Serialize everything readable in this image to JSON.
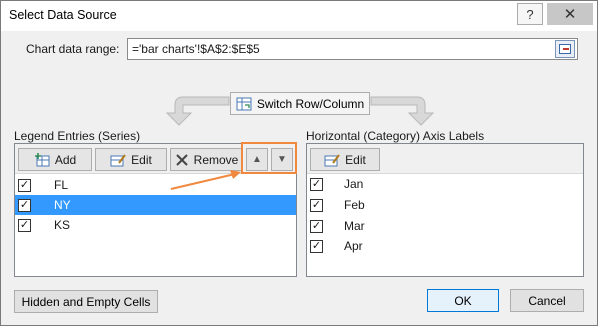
{
  "window": {
    "title": "Select Data Source",
    "help_glyph": "?",
    "close_glyph": "✕"
  },
  "range": {
    "label": "Chart data range:",
    "value": "='bar charts'!$A$2:$E$5"
  },
  "switch_button": {
    "label": "Switch Row/Column"
  },
  "legend": {
    "heading": "Legend Entries (Series)",
    "add_label": "Add",
    "edit_label": "Edit",
    "remove_label": "Remove",
    "items": [
      {
        "label": "FL",
        "checked": true,
        "selected": false
      },
      {
        "label": "NY",
        "checked": true,
        "selected": true
      },
      {
        "label": "KS",
        "checked": true,
        "selected": false
      }
    ]
  },
  "axis": {
    "heading": "Horizontal (Category) Axis Labels",
    "edit_label": "Edit",
    "items": [
      {
        "label": "Jan",
        "checked": true
      },
      {
        "label": "Feb",
        "checked": true
      },
      {
        "label": "Mar",
        "checked": true
      },
      {
        "label": "Apr",
        "checked": true
      }
    ]
  },
  "footer": {
    "hidden_cells_label": "Hidden and Empty Cells",
    "ok_label": "OK",
    "cancel_label": "Cancel"
  },
  "colors": {
    "selection": "#3399ff",
    "annotation": "#f0883e",
    "ok_border": "#0078d7"
  },
  "icons": {
    "check": "✓",
    "up": "▲",
    "down": "▼"
  }
}
